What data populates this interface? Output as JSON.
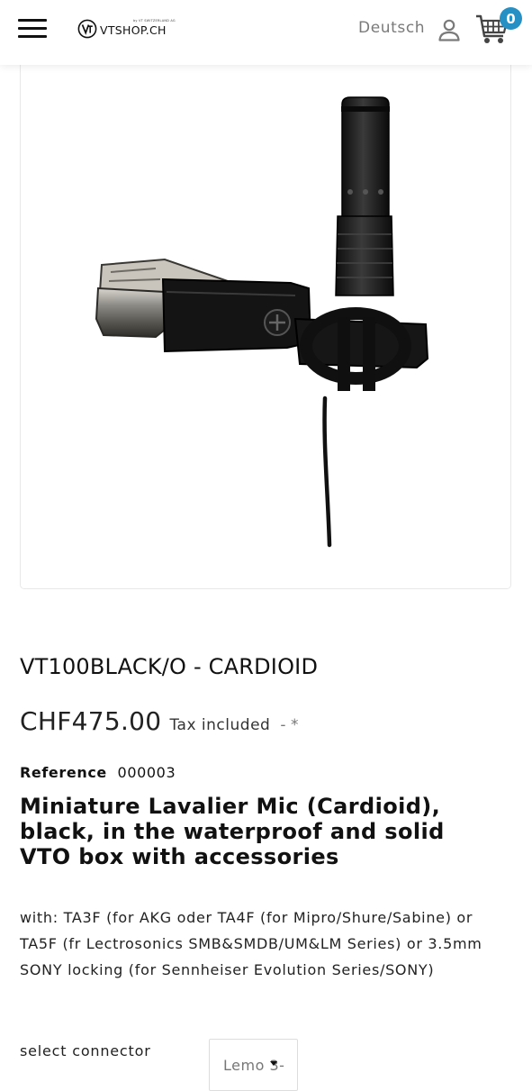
{
  "header": {
    "logo_text": "VTSHOP.CH",
    "logo_subtext": "by VT SWITZERLAND AG",
    "language": "Deutsch",
    "cart_count": "0",
    "accent_color": "#2690c4",
    "icons": [
      "menu-icon",
      "vt-logo-icon",
      "user-icon",
      "cart-icon"
    ]
  },
  "product": {
    "image_alt": "Black miniature lavalier microphone with metal tie clip",
    "title": "VT100BLACK/O - CARDIOID",
    "price": "CHF475.00",
    "tax_label": "Tax included",
    "tax_suffix": "- *",
    "reference_label": "Reference",
    "reference_value": "000003",
    "headline": "Miniature Lavalier Mic (Cardioid), black, in the waterproof and solid VTO box with accessories",
    "description": "with: TA3F (for AKG oder TA4F (for Mipro/Shure/Sabine) or TA5F (fr Lectrosonics SMB&SMDB/UM&LM Series) or 3.5mm SONY locking (for Sennheiser Evolution Series/SONY)"
  },
  "options": {
    "select_label": "select connector",
    "selected_value": "Lemo 3-"
  }
}
